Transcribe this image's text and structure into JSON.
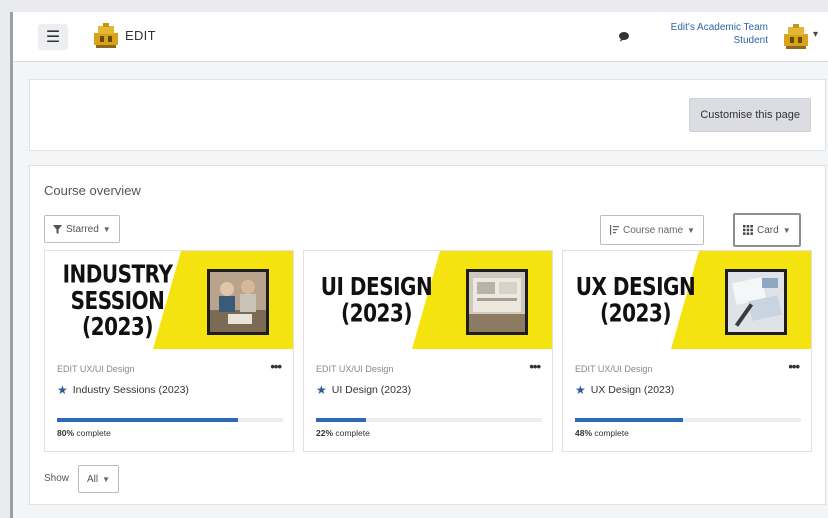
{
  "header": {
    "brand": "EDIT",
    "user_name": "Edit's Academic Team",
    "user_role": "Student"
  },
  "page": {
    "customise_label": "Customise this page"
  },
  "overview": {
    "title": "Course overview",
    "filter_label": "Starred",
    "sort_label": "Course name",
    "view_label": "Card",
    "show_label": "Show",
    "show_value": "All"
  },
  "courses": [
    {
      "image_line1": "INDUSTRY",
      "image_line2": "SESSION",
      "image_line3": "(2023)",
      "category": "EDIT UX/UI Design",
      "name": "Industry Sessions (2023)",
      "progress": 80,
      "progress_pct": "80%",
      "progress_suffix": " complete"
    },
    {
      "image_line1": "UI DESIGN",
      "image_line2": "(2023)",
      "category": "EDIT UX/UI Design",
      "name": "UI Design (2023)",
      "progress": 22,
      "progress_pct": "22%",
      "progress_suffix": " complete"
    },
    {
      "image_line1": "UX DESIGN",
      "image_line2": "(2023)",
      "category": "EDIT UX/UI Design",
      "name": "UX Design (2023)",
      "progress": 48,
      "progress_pct": "48%",
      "progress_suffix": " complete"
    }
  ],
  "colors": {
    "accent": "#2e6ab4",
    "banner_yellow": "#f5e310"
  },
  "icons": {
    "menu": "hamburger-icon",
    "chat": "speech-bubble-icon",
    "filter": "funnel-icon",
    "sort": "sort-icon",
    "view": "grid-icon",
    "star": "star-icon",
    "more": "ellipsis-icon"
  }
}
